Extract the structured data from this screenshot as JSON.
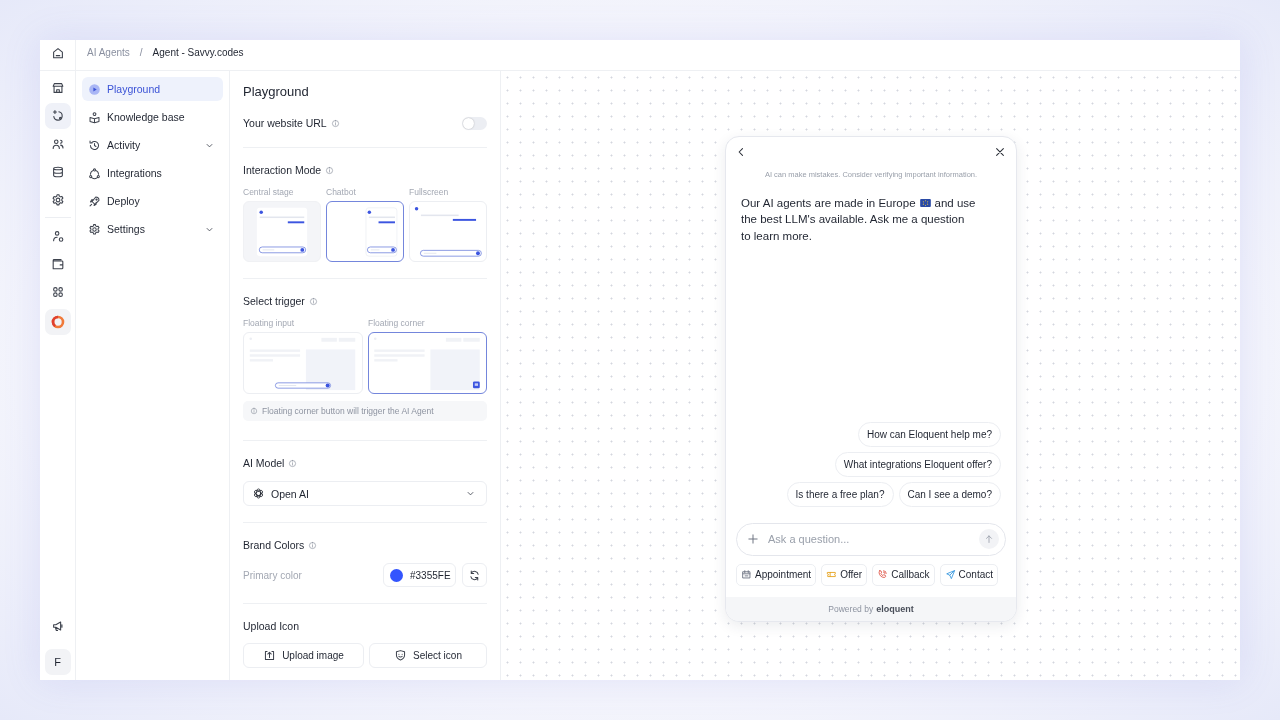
{
  "breadcrumb": {
    "separator": "/",
    "items": [
      {
        "label": "AI Agents",
        "current": false
      },
      {
        "label": "Agent - Savvy.codes",
        "current": true
      }
    ]
  },
  "rail": {
    "groups": [
      [
        {
          "selected": false
        },
        {
          "selected": true
        },
        {
          "selected": false
        },
        {
          "selected": false
        },
        {
          "selected": false
        }
      ],
      [
        {
          "selected": false
        },
        {
          "selected": false
        },
        {
          "selected": false
        }
      ]
    ],
    "avatar_initial": "F"
  },
  "nav": [
    {
      "label": "Playground",
      "selected": true
    },
    {
      "label": "Knowledge base",
      "selected": false
    },
    {
      "label": "Activity",
      "selected": false,
      "expanded": false
    },
    {
      "label": "Integrations",
      "selected": false
    },
    {
      "label": "Deploy",
      "selected": false
    },
    {
      "label": "Settings",
      "selected": false,
      "expanded": false
    }
  ],
  "panel": {
    "title": "Playground",
    "website_url": {
      "label": "Your website URL",
      "on": false
    },
    "interaction_mode": {
      "label": "Interaction Mode",
      "options": [
        {
          "label": "Central stage",
          "kind": "central",
          "selected": false
        },
        {
          "label": "Chatbot",
          "kind": "chatbot",
          "selected": true
        },
        {
          "label": "Fullscreen",
          "kind": "fullscreen",
          "selected": false
        }
      ]
    },
    "trigger": {
      "label": "Select trigger",
      "options": [
        {
          "label": "Floating input",
          "kind": "input",
          "selected": false
        },
        {
          "label": "Floating corner",
          "kind": "corner",
          "selected": true
        }
      ],
      "note": "Floating corner button will trigger the AI Agent"
    },
    "ai_model": {
      "label": "AI Model",
      "value": "Open AI"
    },
    "brand_colors": {
      "label": "Brand Colors",
      "primary_label": "Primary color",
      "primary_value": "#3355FE"
    },
    "upload_icon": {
      "label": "Upload Icon",
      "buttons": [
        {
          "label": "Upload image"
        },
        {
          "label": "Select icon"
        }
      ]
    }
  },
  "chat": {
    "disclaimer": "AI can make mistakes. Consider verifying important information.",
    "message_lines": [
      {
        "segments": [
          {
            "kind": "text",
            "text": "Our AI agents are made in Europe"
          },
          {
            "kind": "flag"
          },
          {
            "kind": "text",
            "text": "and use"
          }
        ]
      },
      {
        "segments": [
          {
            "kind": "text",
            "text": "the best LLM's available. Ask me a question to learn more."
          }
        ]
      }
    ],
    "suggestion_rows": [
      [
        "How can Eloquent help me?"
      ],
      [
        "What integrations Eloquent offer?"
      ],
      [
        "Is there a free plan?",
        "Can I see a demo?"
      ]
    ],
    "input": {
      "placeholder": "Ask a question..."
    },
    "actions": [
      {
        "label": "Appointment"
      },
      {
        "label": "Offer"
      },
      {
        "label": "Callback"
      },
      {
        "label": "Contact"
      }
    ],
    "footer": {
      "prefix": "Powered by",
      "brand": "eloquent"
    }
  }
}
